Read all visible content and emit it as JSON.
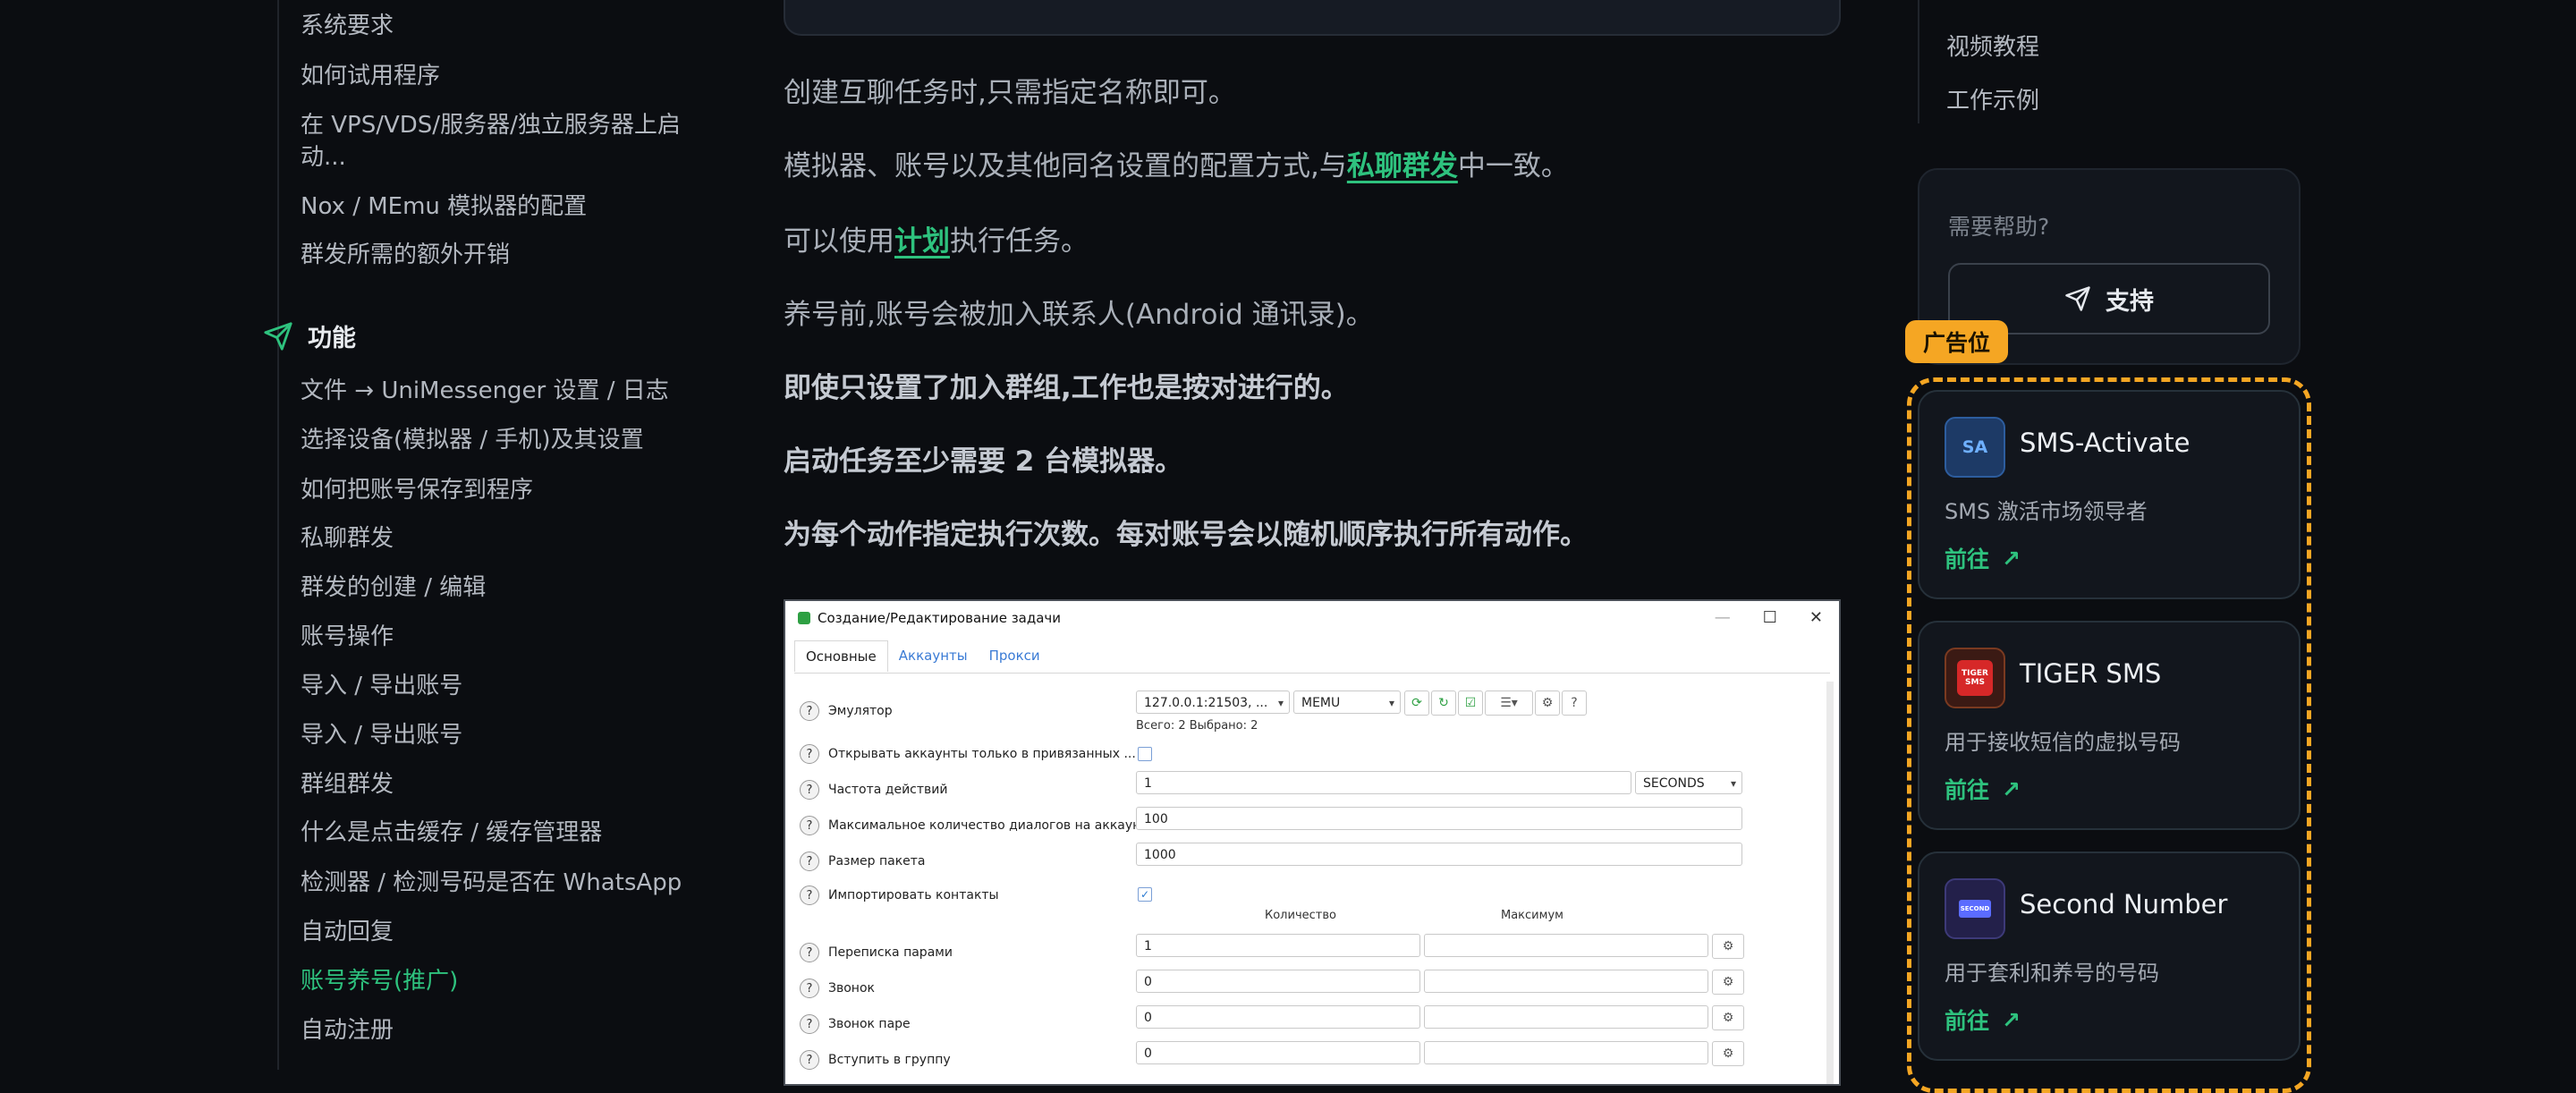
{
  "left_nav": {
    "items_top": [
      "系统要求",
      "如何试用程序",
      "在 VPS/VDS/服务器/独立服务器上启动...",
      "Nox / MEmu 模拟器的配置",
      "群发所需的额外开销"
    ],
    "section_label": "功能",
    "items": [
      "文件 → UniMessenger 设置 / 日志",
      "选择设备(模拟器 / 手机)及其设置",
      "如何把账号保存到程序",
      "私聊群发",
      "群发的创建 / 编辑",
      "账号操作",
      "导入 / 导出账号",
      "导入 / 导出账号",
      "群组群发",
      "什么是点击缓存 / 缓存管理器",
      "检测器 / 检测号码是否在 WhatsApp",
      "自动回复",
      "账号养号(推广)",
      "自动注册"
    ]
  },
  "content": {
    "p1": "创建互聊任务时,只需指定名称即可。",
    "p2_a": "模拟器、账号以及其他同名设置的配置方式,与",
    "p2_link": "私聊群发",
    "p2_b": "中一致。",
    "p3_a": "可以使用",
    "p3_link": "计划",
    "p3_b": "执行任务。",
    "p4": "养号前,账号会被加入联系人(Android 通讯录)。",
    "p5": "即使只设置了加入群组,工作也是按对进行的。",
    "p6": "启动任务至少需要 2 台模拟器。",
    "p7": "为每个动作指定执行次数。每对账号会以随机顺序执行所有动作。"
  },
  "dialog": {
    "title": "Создание/Редактирование задачи",
    "tabs": [
      "Основные",
      "Аккаунты",
      "Прокси"
    ],
    "rows": {
      "emulator": "Эмулятор",
      "open_accounts": "Открывать аккаунты только в привязанных ...",
      "freq": "Частота действий",
      "max_dialogs": "Максимальное количество диалогов на аккаунт",
      "packet": "Размер пакета",
      "import": "Импортировать контакты",
      "pairs": "Переписка парами",
      "call": "Звонок",
      "call_pair": "Звонок паре",
      "join_group": "Вступить в группу"
    },
    "emu_select": "127.0.0.1:21503, ...",
    "emu_type": "MEMU",
    "emu_count": "Всего: 2  Выбрано: 2",
    "freq_value": "1",
    "freq_unit": "SECONDS",
    "max_dialogs_value": "100",
    "packet_value": "1000",
    "col_count": "Количество",
    "col_max": "Максимум",
    "pairs_value": "1",
    "call_value": "0",
    "call_pair_value": "0",
    "join_group_value": "0"
  },
  "right_nav": {
    "items": [
      "视频教程",
      "工作示例"
    ]
  },
  "help": {
    "question": "需要帮助?",
    "support": "支持"
  },
  "ads": {
    "tag": "广告位",
    "cards": [
      {
        "logo": "SA",
        "name": "SMS-Activate",
        "desc": "SMS 激活市场领导者",
        "go": "前往"
      },
      {
        "logo": "TIGER SMS",
        "name": "TIGER SMS",
        "desc": "用于接收短信的虚拟号码",
        "go": "前往"
      },
      {
        "logo": "SECOND",
        "name": "Second Number",
        "desc": "用于套利和养号的号码",
        "go": "前往"
      }
    ]
  },
  "colors": {
    "accent": "#2ec27e",
    "ad": "#f5a623",
    "background": "#0b0d11"
  }
}
